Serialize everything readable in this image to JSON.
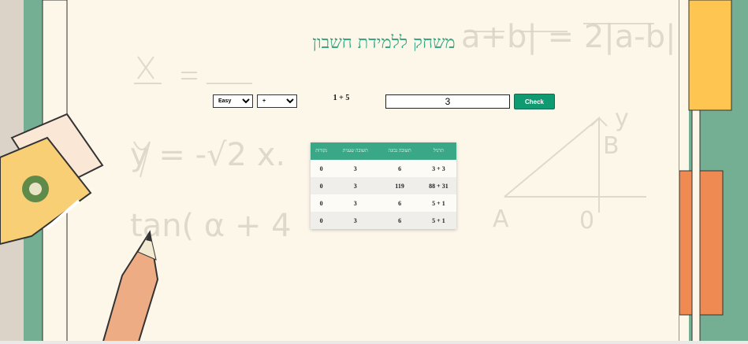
{
  "title": "משחק ללמידת חשבון",
  "controls": {
    "difficulty": {
      "selected": "Easy",
      "options": [
        "Easy"
      ]
    },
    "operator": {
      "selected": "+",
      "options": [
        "+"
      ]
    },
    "problem": "1 + 5",
    "answer_value": "3",
    "check_label": "Check"
  },
  "table": {
    "headers": [
      "תרגיל",
      "תשובה נכונה",
      "תשובה שענית",
      "נקודות"
    ],
    "rows": [
      [
        "3 + 3",
        "6",
        "3",
        "0"
      ],
      [
        "31 + 88",
        "119",
        "3",
        "0"
      ],
      [
        "1 + 5",
        "6",
        "3",
        "0"
      ],
      [
        "1 + 5",
        "6",
        "3",
        "0"
      ]
    ]
  },
  "colors": {
    "accent": "#3aa887",
    "button": "#0f9a72",
    "background": "#fdf7ea"
  }
}
